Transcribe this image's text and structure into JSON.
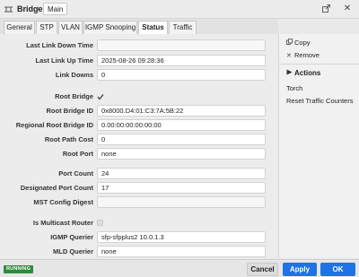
{
  "title": {
    "app": "Bridge",
    "breadcrumb": "Main"
  },
  "tabs": [
    {
      "label": "General",
      "active": false
    },
    {
      "label": "STP",
      "active": false
    },
    {
      "label": "VLAN",
      "active": false
    },
    {
      "label": "IGMP Snooping",
      "active": false
    },
    {
      "label": "Status",
      "active": true
    },
    {
      "label": "Traffic",
      "active": false
    }
  ],
  "fields": {
    "last_link_down_time": {
      "label": "Last Link Down Time",
      "value": ""
    },
    "last_link_up_time": {
      "label": "Last Link Up Time",
      "value": "2025-08-26 09:28:36"
    },
    "link_downs": {
      "label": "Link Downs",
      "value": "0"
    },
    "root_bridge": {
      "label": "Root Bridge",
      "checked": true
    },
    "root_bridge_id": {
      "label": "Root Bridge ID",
      "value": "0x8000.D4:01:C3:7A:5B:22"
    },
    "regional_root_bridge_id": {
      "label": "Regional Root Bridge ID",
      "value": "0.00:00:00:00:00:00"
    },
    "root_path_cost": {
      "label": "Root Path Cost",
      "value": "0"
    },
    "root_port": {
      "label": "Root Port",
      "value": "none"
    },
    "port_count": {
      "label": "Port Count",
      "value": "24"
    },
    "designated_port_count": {
      "label": "Designated Port Count",
      "value": "17"
    },
    "mst_config_digest": {
      "label": "MST Config Digest",
      "value": ""
    },
    "is_multicast_router": {
      "label": "Is Multicast Router",
      "checked": false
    },
    "igmp_querier": {
      "label": "IGMP Querier",
      "value": "sfp-sfpplus2 10.0.1.3"
    },
    "mld_querier": {
      "label": "MLD Querier",
      "value": "none"
    }
  },
  "sidebar": {
    "copy": "Copy",
    "remove": "Remove",
    "actions_heading": "Actions",
    "torch": "Torch",
    "reset_traffic": "Reset Traffic Counters"
  },
  "footer": {
    "status": "RUNNING",
    "cancel": "Cancel",
    "apply": "Apply",
    "ok": "OK"
  },
  "colors": {
    "primary": "#1e73e6",
    "running": "#2e8b3b"
  }
}
